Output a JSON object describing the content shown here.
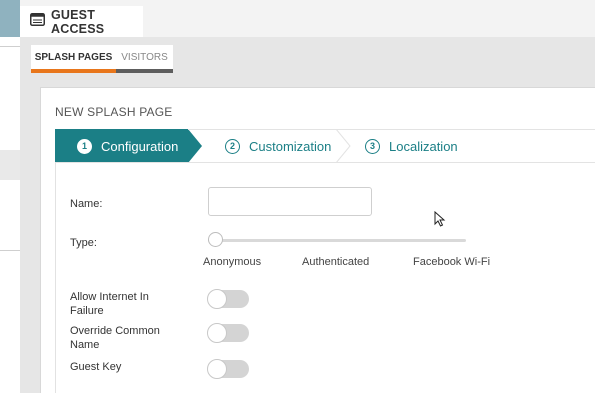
{
  "header": {
    "title": "GUEST ACCESS",
    "icon": "window-icon"
  },
  "subtabs": [
    {
      "label": "SPLASH PAGES",
      "active": true
    },
    {
      "label": "VISITORS",
      "active": false
    }
  ],
  "panel": {
    "title": "NEW SPLASH PAGE"
  },
  "wizard": {
    "steps": [
      {
        "number": "1",
        "label": "Configuration",
        "active": true
      },
      {
        "number": "2",
        "label": "Customization",
        "active": false
      },
      {
        "number": "3",
        "label": "Localization",
        "active": false
      }
    ]
  },
  "form": {
    "name_label": "Name:",
    "name_value": "",
    "type_label": "Type:",
    "type_options": [
      "Anonymous",
      "Authenticated",
      "Facebook Wi-Fi"
    ],
    "type_selected": "Anonymous",
    "allow_internet_label": "Allow Internet In Failure",
    "override_label": "Override Common Name",
    "guest_key_label": "Guest Key"
  },
  "colors": {
    "accent": "#1b7f86",
    "tab_underline": "#e8761b"
  }
}
